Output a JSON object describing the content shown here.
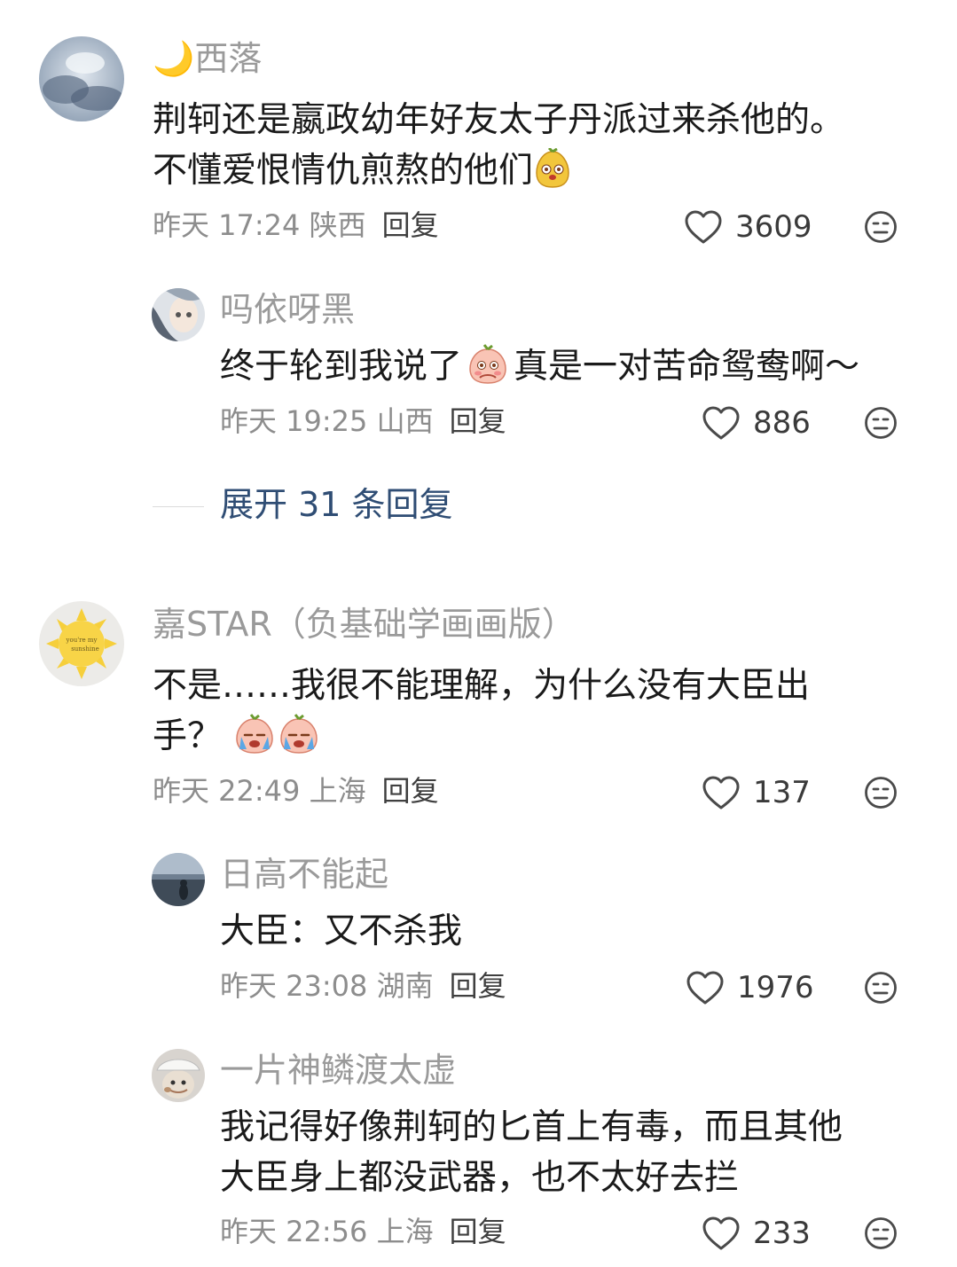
{
  "comments": [
    {
      "name": "🌙西落",
      "text_lines": [
        "荆轲还是嬴政幼年好友太子丹派过来杀他的。",
        "不懂爱恨情仇煎熬的他们"
      ],
      "time": "昨天 17:24 陕西",
      "reply_label": "回复",
      "likes": "3609"
    },
    {
      "name": "吗依呀黑",
      "text_lines": [
        "终于轮到我说了",
        "真是一对苦命鸳鸯啊～"
      ],
      "time": "昨天 19:25 山西",
      "reply_label": "回复",
      "likes": "886"
    },
    {
      "name": "嘉STAR（负基础学画画版）",
      "text_lines": [
        "不是……我很不能理解，为什么没有大臣出",
        "手？"
      ],
      "time": "昨天 22:49 上海",
      "reply_label": "回复",
      "likes": "137"
    },
    {
      "name": "日高不能起",
      "text_lines": [
        "大臣：又不杀我"
      ],
      "time": "昨天 23:08 湖南",
      "reply_label": "回复",
      "likes": "1976"
    },
    {
      "name": "一片神鳞渡太虚",
      "text_lines": [
        "我记得好像荆轲的匕首上有毒，而且其他",
        "大臣身上都没武器，也不太好去拦"
      ],
      "time": "昨天 22:56 上海",
      "reply_label": "回复",
      "likes": "233"
    }
  ],
  "expand_replies": "展开 31 条回复",
  "icons": {
    "like": "heart-outline-icon",
    "more": "meh-face-icon",
    "emoji_a": "cute-mascot-emoji",
    "emoji_b": "shy-peach-emoji",
    "emoji_c": "crying-peach-emoji"
  },
  "colors": {
    "text": "#1a1a1a",
    "username": "#9a9a9a",
    "meta": "#8d8d8d",
    "expand_link": "#2f4d74"
  }
}
